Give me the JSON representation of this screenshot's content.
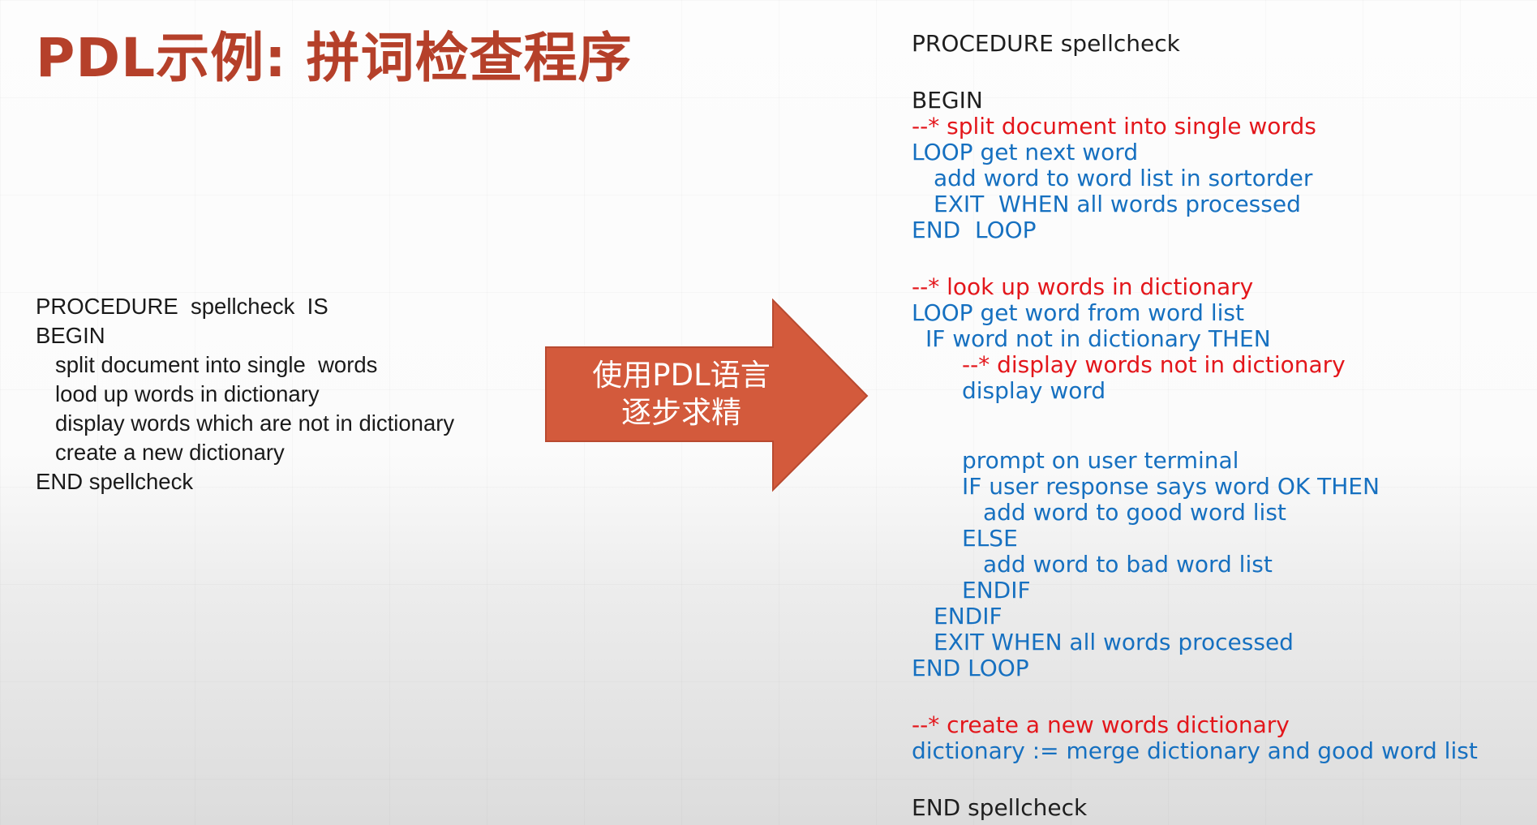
{
  "slide": {
    "title": "PDL示例: 拼词检查程序",
    "colors": {
      "title": "#b5402a",
      "arrow_fill": "#d35a3c",
      "arrow_stroke": "#b94a30",
      "comment": "#e3161b",
      "code": "#1670c0",
      "plain": "#1e1e1e"
    }
  },
  "left_code": {
    "line_1": "PROCEDURE  spellcheck  IS",
    "line_2": "BEGIN",
    "line_3": "split document into single  words",
    "line_4": "lood up words in dictionary",
    "line_5": "display words which are not in dictionary",
    "line_6": "create a new dictionary",
    "line_7": "END spellcheck"
  },
  "arrow": {
    "line_1": "使用PDL语言",
    "line_2": "逐步求精"
  },
  "right_code": {
    "procedure": "PROCEDURE spellcheck",
    "begin": "BEGIN",
    "comment_split": "--* split document into single words",
    "loop_next": "LOOP get next word",
    "add_sortorder": "add word to word list in sortorder",
    "exit_when_1": "EXIT  WHEN all words processed",
    "end_loop_1": "END  LOOP",
    "comment_lookup": "--* look up words in dictionary",
    "loop_from_list": "LOOP get word from word list",
    "if_not_in_dict": "IF word not in dictionary THEN",
    "comment_display": "--* display words not in dictionary",
    "display_word": "display word",
    "prompt": "prompt on user terminal",
    "if_user_ok": "IF user response says word OK THEN",
    "add_good": "add word to good word list",
    "else": "ELSE",
    "add_bad": "add word to bad word list",
    "endif_inner": "ENDIF",
    "endif_outer": "ENDIF",
    "exit_when_2": "EXIT WHEN all words processed",
    "end_loop_2": "END LOOP",
    "comment_create": "--* create a new words dictionary",
    "merge": "dictionary := merge dictionary and good word list",
    "end": "END spellcheck"
  }
}
